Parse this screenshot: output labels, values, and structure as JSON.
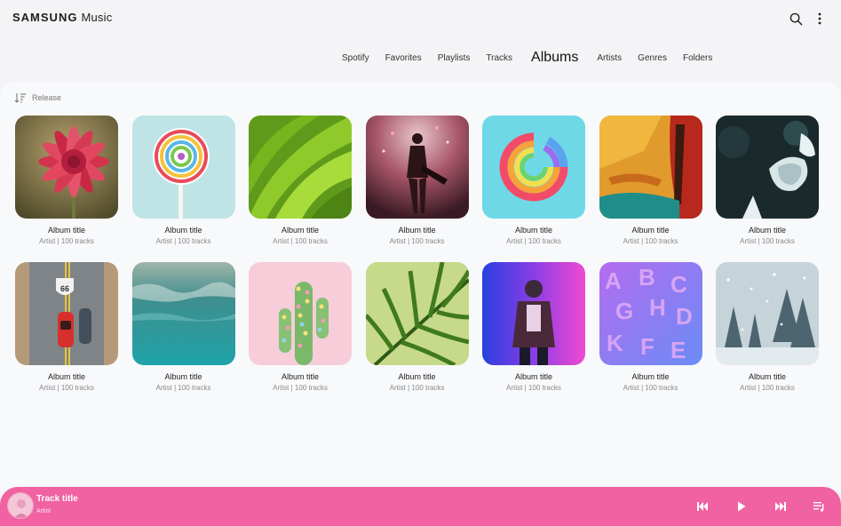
{
  "app": {
    "brand_primary": "SAMSUNG",
    "brand_secondary": "Music",
    "accent_color": "#f062a2"
  },
  "header": {
    "icons": [
      "search-icon",
      "more-vertical-icon"
    ]
  },
  "tabs": [
    {
      "label": "Spotify",
      "active": false
    },
    {
      "label": "Favorites",
      "active": false
    },
    {
      "label": "Playlists",
      "active": false
    },
    {
      "label": "Tracks",
      "active": false
    },
    {
      "label": "Albums",
      "active": true
    },
    {
      "label": "Artists",
      "active": false
    },
    {
      "label": "Genres",
      "active": false
    },
    {
      "label": "Folders",
      "active": false
    }
  ],
  "sort": {
    "label": "Release",
    "icon": "sort-icon"
  },
  "albums": [
    {
      "title": "Album title",
      "subtitle": "Artist | 100 tracks",
      "art": "pink-flower"
    },
    {
      "title": "Album title",
      "subtitle": "Artist | 100 tracks",
      "art": "lollipop"
    },
    {
      "title": "Album title",
      "subtitle": "Artist | 100 tracks",
      "art": "green-leaves"
    },
    {
      "title": "Album title",
      "subtitle": "Artist | 100 tracks",
      "art": "guitarist-concert"
    },
    {
      "title": "Album title",
      "subtitle": "Artist | 100 tracks",
      "art": "rainbow-slinky"
    },
    {
      "title": "Album title",
      "subtitle": "Artist | 100 tracks",
      "art": "abstract-paint"
    },
    {
      "title": "Album title",
      "subtitle": "Artist | 100 tracks",
      "art": "ice-crystals"
    },
    {
      "title": "Album title",
      "subtitle": "Artist | 100 tracks",
      "art": "route-66-road"
    },
    {
      "title": "Album title",
      "subtitle": "Artist | 100 tracks",
      "art": "teal-water"
    },
    {
      "title": "Album title",
      "subtitle": "Artist | 100 tracks",
      "art": "candy-cactus"
    },
    {
      "title": "Album title",
      "subtitle": "Artist | 100 tracks",
      "art": "palm-leaf"
    },
    {
      "title": "Album title",
      "subtitle": "Artist | 100 tracks",
      "art": "neon-portrait"
    },
    {
      "title": "Album title",
      "subtitle": "Artist | 100 tracks",
      "art": "purple-letters"
    },
    {
      "title": "Album title",
      "subtitle": "Artist | 100 tracks",
      "art": "snowy-forest"
    }
  ],
  "player": {
    "track_title": "Track title",
    "artist": "Artist",
    "controls": [
      "previous-icon",
      "play-icon",
      "next-icon",
      "queue-icon"
    ]
  }
}
